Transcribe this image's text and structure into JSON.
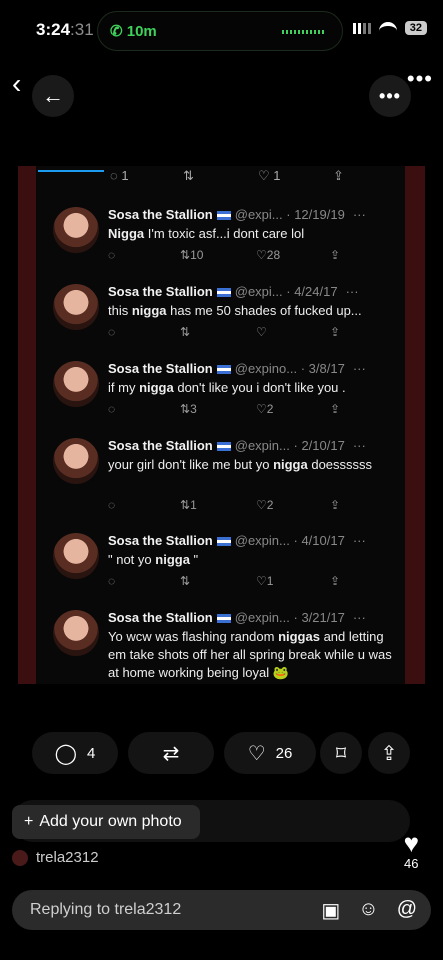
{
  "status": {
    "time": "3:24",
    "time_ghost": ":31",
    "call_label": "10m",
    "battery": "32"
  },
  "nav": {
    "back_glyph": "‹",
    "back_arrow": "←",
    "more_glyph": "•••"
  },
  "screenshot": {
    "top_actions": {
      "reply": "1",
      "like": "1"
    },
    "tweets": [
      {
        "name": "Sosa the Stallion",
        "handle": "@expi...",
        "date": "· 12/19/19",
        "text_bold": "Nigga",
        "text": " I'm toxic asf...i dont care lol",
        "retweets": "10",
        "likes": "28"
      },
      {
        "name": "Sosa the Stallion",
        "handle": "@expi...",
        "date": "· 4/24/17",
        "text_pre": "this ",
        "text_bold": "nigga",
        "text": " has me 50 shades of fucked up...",
        "retweets": "",
        "likes": ""
      },
      {
        "name": "Sosa the Stallion",
        "handle": "@expino...",
        "date": "· 3/8/17",
        "text_pre": "if my ",
        "text_bold": "nigga",
        "text": " don't like you i don't like you .",
        "retweets": "3",
        "likes": "2"
      },
      {
        "name": "Sosa the Stallion",
        "handle": "@expin...",
        "date": "· 2/10/17",
        "text_pre": "your girl don't like me but yo ",
        "text_bold": "nigga",
        "text": " doessssss",
        "retweets": "1",
        "likes": "2"
      },
      {
        "name": "Sosa the Stallion",
        "handle": "@expin...",
        "date": "· 4/10/17",
        "text_pre": "\" not yo ",
        "text_bold": "nigga",
        "text": " \"",
        "retweets": "",
        "likes": "1"
      },
      {
        "name": "Sosa the Stallion",
        "handle": "@expin...",
        "date": "· 3/21/17",
        "text_pre": "Yo wcw was flashing random ",
        "text_bold": "niggas",
        "text": " and letting em take shots off her all spring break while u was at home working being loyal 🐸",
        "retweets": "",
        "likes": ""
      }
    ]
  },
  "engagement": {
    "replies": "4",
    "likes": "26"
  },
  "add_photo": {
    "label": "Add your own photo"
  },
  "comment": {
    "username": "trela2312",
    "like_count": "46"
  },
  "reply_box": {
    "placeholder": "Replying to trela2312"
  },
  "colors": {
    "accent_blue": "#1d9bf0",
    "call_green": "#3fd15a",
    "flag_blue": "#3c6fd4"
  }
}
